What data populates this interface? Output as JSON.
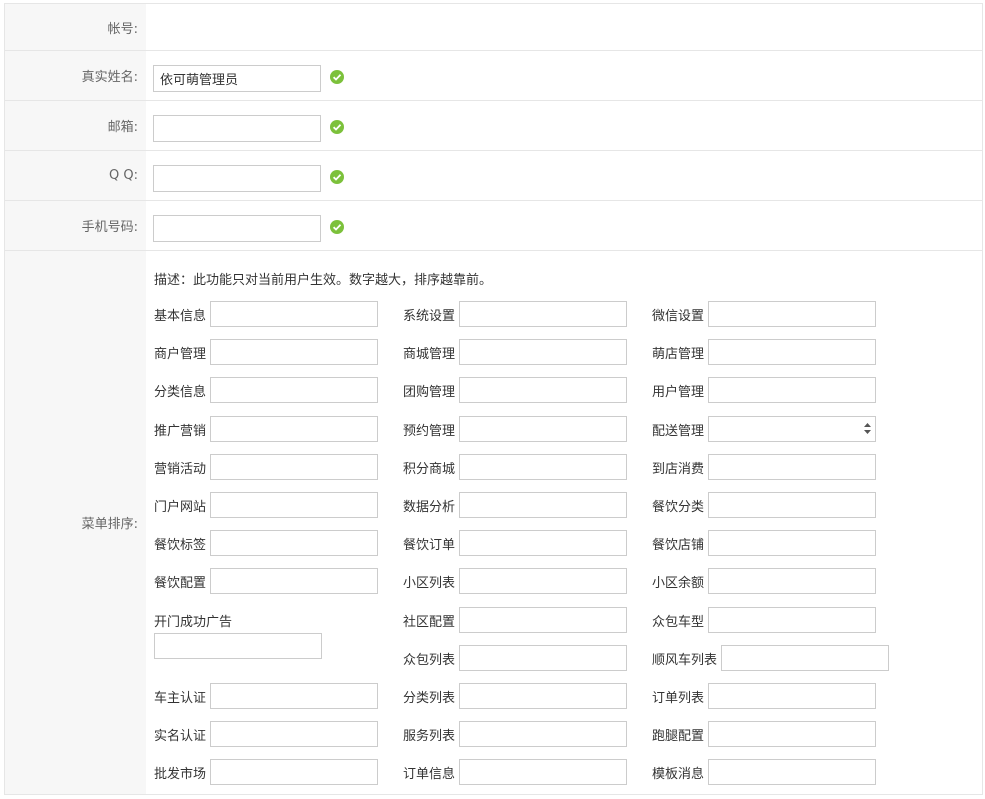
{
  "fields": {
    "account": {
      "label": "帐号:"
    },
    "realname": {
      "label": "真实姓名:",
      "value": "依可萌管理员"
    },
    "email": {
      "label": "邮箱:",
      "value": ""
    },
    "qq": {
      "label": "Q Q:",
      "value": ""
    },
    "phone": {
      "label": "手机号码:",
      "value": ""
    }
  },
  "menu_sort": {
    "label": "菜单排序:",
    "description": "描述：此功能只对当前用户生效。数字越大，排序越靠前。",
    "items": [
      [
        "基本信息",
        "系统设置",
        "微信设置"
      ],
      [
        "商户管理",
        "商城管理",
        "萌店管理"
      ],
      [
        "分类信息",
        "团购管理",
        "用户管理"
      ],
      [
        "推广营销",
        "预约管理",
        "配送管理"
      ],
      [
        "营销活动",
        "积分商城",
        "到店消费"
      ],
      [
        "门户网站",
        "数据分析",
        "餐饮分类"
      ],
      [
        "餐饮标签",
        "餐饮订单",
        "餐饮店铺"
      ],
      [
        "餐饮配置",
        "小区列表",
        "小区余额"
      ],
      [
        "开门成功广告",
        "社区配置",
        "众包车型"
      ],
      [
        "",
        "众包列表",
        "顺风车列表"
      ],
      [
        "车主认证",
        "分类列表",
        "订单列表"
      ],
      [
        "实名认证",
        "服务列表",
        "跑腿配置"
      ],
      [
        "批发市场",
        "订单信息",
        "模板消息"
      ]
    ]
  },
  "colors": {
    "valid": "#7cc13b",
    "border": "#cccccc",
    "label_bg": "#f7f7f7"
  }
}
